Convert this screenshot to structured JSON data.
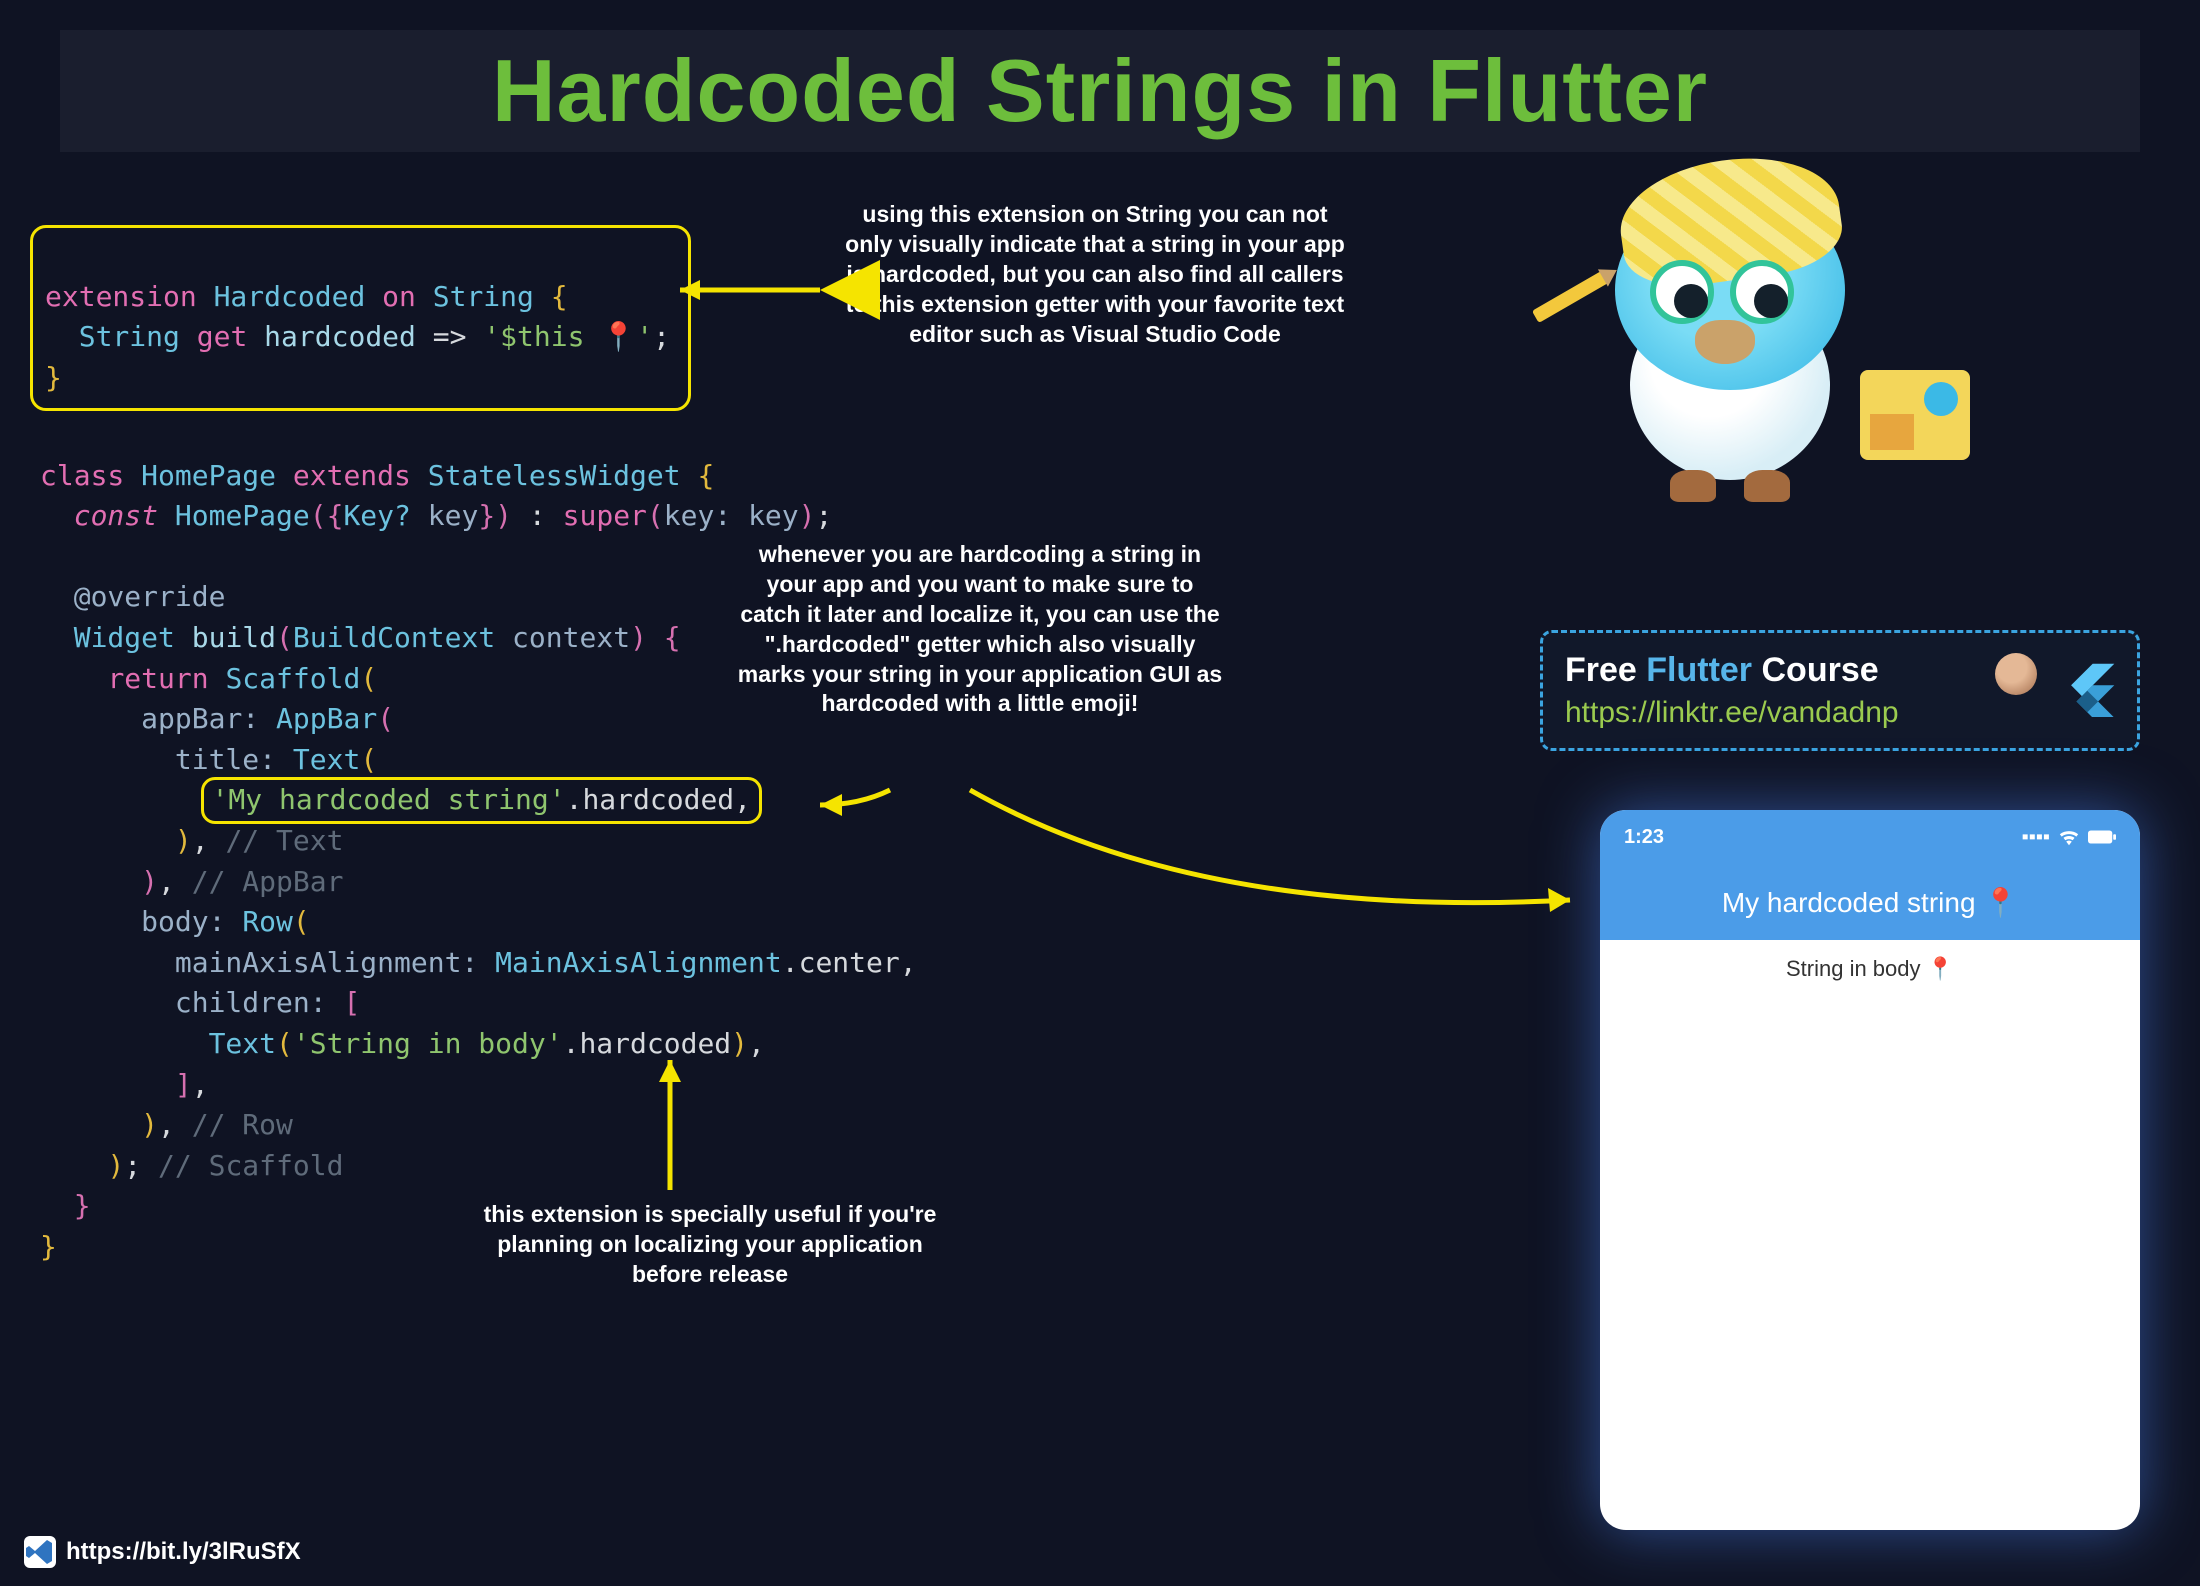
{
  "title": "Hardcoded Strings in Flutter",
  "annotations": {
    "a1": "using this extension on String you can not only visually indicate that a string in your app is hardcoded, but you can also find all callers to this extension getter with your favorite text editor such as Visual Studio Code",
    "a2": "whenever you are hardcoding a string in your app and you want to make sure to catch it later and localize it, you can use the \".hardcoded\" getter which also visually marks your string in your application GUI as hardcoded with a little emoji!",
    "a3": "this extension is specially useful if you're planning on localizing your application before release"
  },
  "extension_code": {
    "l1_extension": "extension",
    "l1_name": "Hardcoded",
    "l1_on": "on",
    "l1_type": "String",
    "l2_type": "String",
    "l2_get": "get",
    "l2_id": "hardcoded",
    "l2_arrow": "=>",
    "l2_str": "'$this 📍'",
    "l2_semi": ";"
  },
  "class_code": {
    "class_kw": "class",
    "class_name": "HomePage",
    "extends_kw": "extends",
    "super_name": "StatelessWidget",
    "const_kw": "const",
    "ctor": "HomePage",
    "key_type": "Key?",
    "key_name": "key",
    "super_call": "super",
    "override": "@override",
    "widget": "Widget",
    "build": "build",
    "buildctx": "BuildContext",
    "ctx": "context",
    "return": "return",
    "scaffold": "Scaffold",
    "appbar_k": "appBar:",
    "appbar": "AppBar",
    "title_k": "title:",
    "text": "Text",
    "hard_str": "'My hardcoded string'",
    "hardcoded": ".hardcoded",
    "cmt_text": "// Text",
    "cmt_appbar": "// AppBar",
    "body_k": "body:",
    "row": "Row",
    "maa_k": "mainAxisAlignment:",
    "maa_v": "MainAxisAlignment",
    "center": ".center",
    "children_k": "children:",
    "body_str": "'String in body'",
    "cmt_row": "// Row",
    "cmt_scaffold": "// Scaffold"
  },
  "course": {
    "free": "Free ",
    "flutter": "Flutter",
    "course": " Course",
    "url": "https://linktr.ee/vandadnp"
  },
  "phone": {
    "time": "1:23",
    "appbar_title": "My hardcoded string 📍",
    "body_text": "String in body 📍"
  },
  "footer": {
    "url": "https://bit.ly/3lRuSfX"
  }
}
